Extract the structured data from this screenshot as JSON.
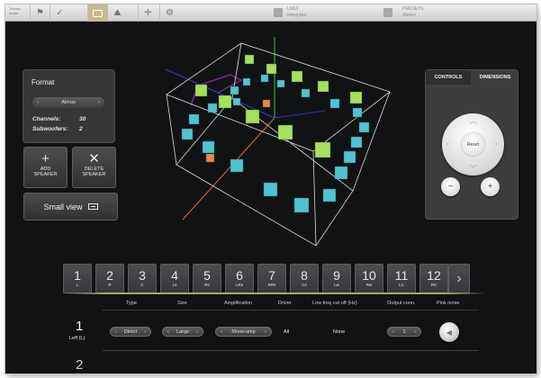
{
  "topbar": {
    "logo_lines": [
      "Trinnov",
      "Audio"
    ],
    "icons": [
      "home-icon",
      "flag-icon",
      "check-icon",
      "display-icon",
      "mountain-icon",
      "crosshair-icon",
      "gear-icon"
    ],
    "active_icon": "display-icon",
    "info1": {
      "line1": "LMUI",
      "line2": "Integrator"
    },
    "info2": {
      "line1": "PRESETS",
      "line2": "Stereo"
    }
  },
  "format": {
    "title": "Format",
    "selected": "Atmos",
    "channels_label": "Channels:",
    "channels_value": "30",
    "subwoofers_label": "Subwoofers:",
    "subwoofers_value": "2"
  },
  "actions": {
    "add_glyph": "+",
    "add_label_1": "ADD",
    "add_label_2": "SPEAKER",
    "delete_glyph": "✕",
    "delete_label_1": "DELETE",
    "delete_label_2": "SPEAKER",
    "small_view": "Small view"
  },
  "controls": {
    "tab_controls": "CONTROLS",
    "tab_dimensions": "DIMENSIONS",
    "active_tab": "CONTROLS",
    "reset": "Reset",
    "zoom_out_glyph": "−",
    "zoom_in_glyph": "+"
  },
  "colors": {
    "background": "#111214",
    "panel": "#343638",
    "speaker_cyan": "#4fc4cf",
    "speaker_green": "#a6e05a",
    "speaker_orange": "#e58a3a",
    "axis_blue": "#3a3ad8",
    "axis_orange": "#e06a1e",
    "axis_purple": "#8a2ea8",
    "accent_gold": "#b0a26e"
  },
  "channels": [
    {
      "num": "1",
      "abbr": "L"
    },
    {
      "num": "2",
      "abbr": "R"
    },
    {
      "num": "3",
      "abbr": "C"
    },
    {
      "num": "4",
      "abbr": "Ls"
    },
    {
      "num": "5",
      "abbr": "Rs"
    },
    {
      "num": "6",
      "abbr": "LRs"
    },
    {
      "num": "7",
      "abbr": "RRs"
    },
    {
      "num": "8",
      "abbr": "Cs"
    },
    {
      "num": "9",
      "abbr": "Lw"
    },
    {
      "num": "10",
      "abbr": "Rw"
    },
    {
      "num": "11",
      "abbr": "LC"
    },
    {
      "num": "12",
      "abbr": "RC"
    }
  ],
  "table": {
    "headers": [
      "Type",
      "Size",
      "Amplification",
      "Driver",
      "Low freq cut-off (Hz)",
      "Output conn.",
      "Pink noise"
    ],
    "row": {
      "number": "1",
      "name": "Left (L)",
      "type": "Direct",
      "size": "Large",
      "amplification": "Mono-amp",
      "driver": "All",
      "low_freq": "None",
      "output": "1"
    },
    "next_row_number": "2"
  }
}
